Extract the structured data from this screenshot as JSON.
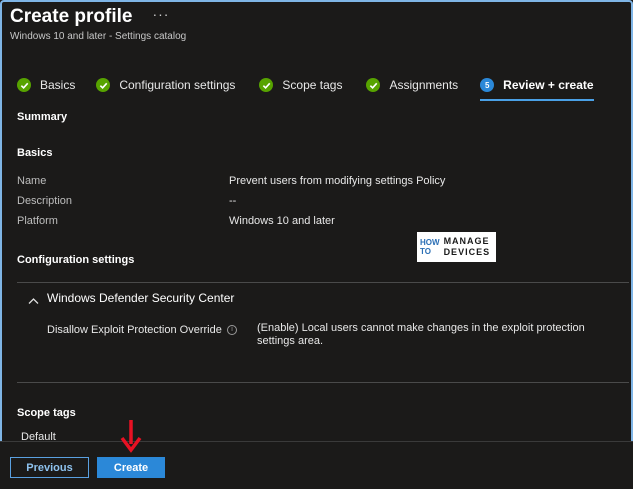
{
  "header": {
    "title": "Create profile",
    "more": "···",
    "subtitle": "Windows 10 and later - Settings catalog"
  },
  "tabs": [
    {
      "label": "Basics",
      "state": "done"
    },
    {
      "label": "Configuration settings",
      "state": "done"
    },
    {
      "label": "Scope tags",
      "state": "done"
    },
    {
      "label": "Assignments",
      "state": "done"
    },
    {
      "label": "Review + create",
      "state": "active",
      "step": "5"
    }
  ],
  "summary": {
    "heading": "Summary",
    "basics": {
      "heading": "Basics",
      "rows": [
        {
          "label": "Name",
          "value": "Prevent users from modifying settings Policy"
        },
        {
          "label": "Description",
          "value": "--"
        },
        {
          "label": "Platform",
          "value": "Windows 10 and later"
        }
      ]
    },
    "configuration": {
      "heading": "Configuration settings",
      "group": "Windows Defender Security Center",
      "setting_label": "Disallow Exploit Protection Override",
      "setting_value": "(Enable) Local users cannot make changes in the exploit protection settings area."
    },
    "scope": {
      "heading": "Scope tags",
      "value": "Default"
    }
  },
  "logo": {
    "how": "HOW",
    "to": "TO",
    "manage": "MANAGE",
    "devices": "DEVICES"
  },
  "footer": {
    "previous": "Previous",
    "create": "Create"
  },
  "colors": {
    "background": "#1b1a19",
    "accent": "#2b88d8",
    "success": "#57a300",
    "arrow": "#e81123"
  }
}
